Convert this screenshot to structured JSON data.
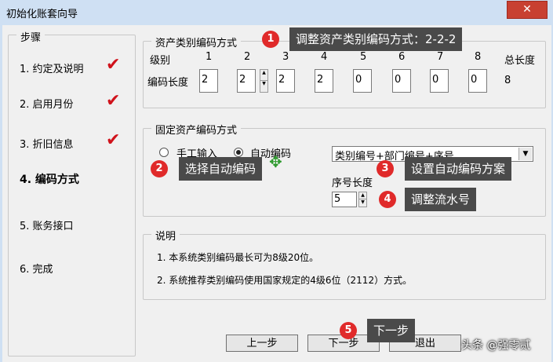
{
  "window": {
    "title": "初始化账套向导",
    "close_icon": "✕"
  },
  "steps": {
    "title": "步骤",
    "items": [
      {
        "label": "1. 约定及说明",
        "done": true
      },
      {
        "label": "2. 启用月份",
        "done": true
      },
      {
        "label": "3. 折旧信息",
        "done": true
      },
      {
        "label": "4. 编码方式",
        "done": false,
        "current": true
      },
      {
        "label": "5. 账务接口",
        "done": false
      },
      {
        "label": "6. 完成",
        "done": false
      }
    ],
    "check_glyph": "✔"
  },
  "asset_coding": {
    "title": "资产类别编码方式",
    "level_label": "级别",
    "length_label": "编码长度",
    "total_label": "总长度",
    "total_value": "8",
    "levels": [
      "1",
      "2",
      "3",
      "4",
      "5",
      "6",
      "7",
      "8"
    ],
    "values": [
      "2",
      "2",
      "2",
      "2",
      "0",
      "0",
      "0",
      "0"
    ]
  },
  "fixed_coding": {
    "title": "固定资产编码方式",
    "manual_label": "手工输入",
    "auto_label": "自动编码",
    "selected": "auto",
    "scheme_value": "类别编号+部门编号+序号",
    "seq_label": "序号长度",
    "seq_value": "5"
  },
  "notes": {
    "title": "说明",
    "lines": [
      "1. 本系统类别编码最长可为8级20位。",
      "2. 系统推荐类别编码使用国家规定的4级6位（2112）方式。"
    ]
  },
  "buttons": {
    "prev": "上一步",
    "next": "下一步",
    "exit": "退出"
  },
  "annotations": [
    {
      "num": "1",
      "text": "调整资产类别编码方式：2-2-2"
    },
    {
      "num": "2",
      "text": "选择自动编码"
    },
    {
      "num": "3",
      "text": "设置自动编码方案"
    },
    {
      "num": "4",
      "text": "调整流水号"
    },
    {
      "num": "5",
      "text": "下一步"
    }
  ],
  "watermark": "头条 @强零贰"
}
